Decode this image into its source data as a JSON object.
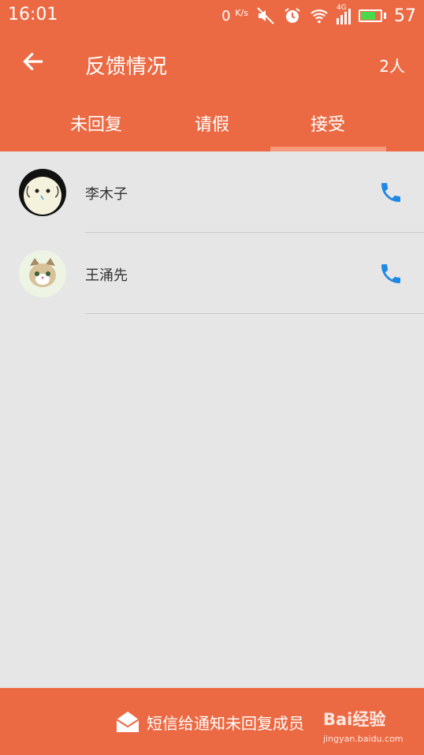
{
  "status_bar": {
    "time": "16:01",
    "net_speed": "0",
    "net_unit": "K/s",
    "network": "4G",
    "battery": "57",
    "icons": [
      "mute-icon",
      "alarm-icon",
      "wifi-icon",
      "signal-icon",
      "battery-icon"
    ]
  },
  "header": {
    "title": "反馈情况",
    "count": "2人"
  },
  "tabs": [
    {
      "label": "未回复"
    },
    {
      "label": "请假"
    },
    {
      "label": "接受",
      "selected": true
    }
  ],
  "members": [
    {
      "name": "李木子",
      "avatar": "cartoon-ghost"
    },
    {
      "name": "王涌先",
      "avatar": "cartoon-kitten"
    }
  ],
  "bottom": {
    "sms_label": "短信给通知未回复成员"
  },
  "watermark": {
    "main": "Bai经验",
    "sub": "jingyan.baidu.com"
  },
  "colors": {
    "primary": "#ec6a43",
    "tab_indicator": "#f59a7c",
    "call_icon": "#1e88e5",
    "background": "#e6e6e6"
  }
}
